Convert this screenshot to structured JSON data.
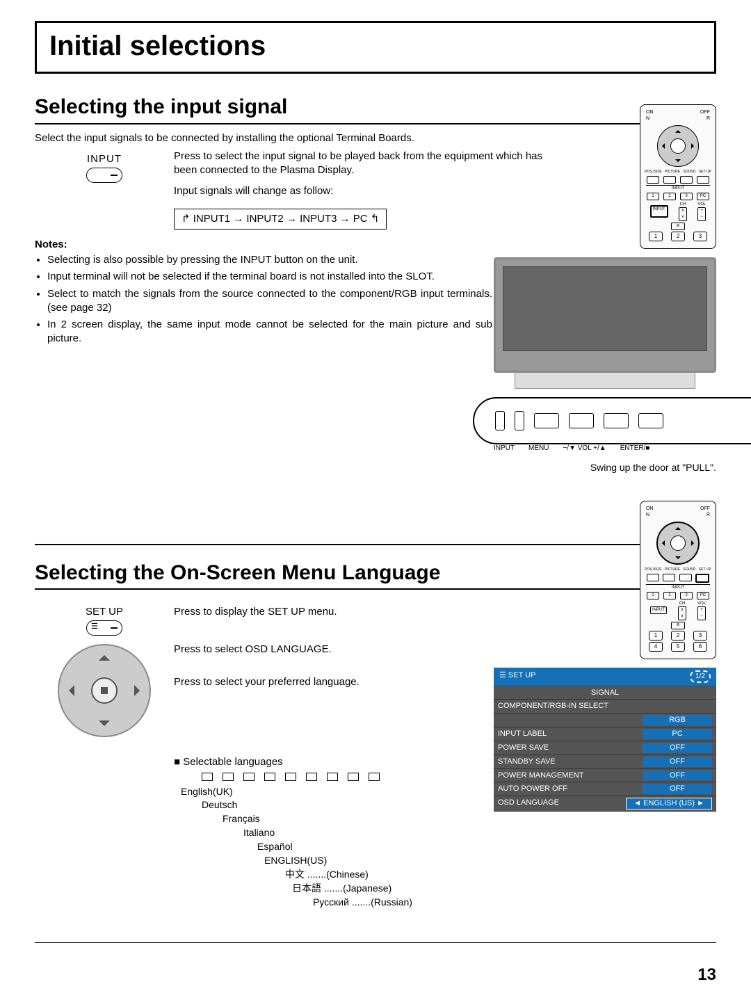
{
  "page": {
    "title": "Initial selections",
    "number": "13"
  },
  "section1": {
    "heading": "Selecting the input signal",
    "intro": "Select the input signals to be connected by installing the optional Terminal Boards.",
    "button_label": "INPUT",
    "press_text": "Press to select the input signal to be played back from the equipment which has been connected to the Plasma Display.",
    "change_text": "Input signals will change as follow:",
    "flow": "INPUT1 → INPUT2 → INPUT3 → PC",
    "notes_label": "Notes:",
    "notes": [
      "Selecting is also possible by pressing the INPUT button on the unit.",
      "Input terminal will not be selected if the terminal board is not installed into the SLOT.",
      "Select to match the signals from the source connected to the component/RGB input terminals. (see page 32)",
      "In 2 screen display, the same input mode cannot be selected for the main picture and sub picture."
    ],
    "tv_caption": "Swing up the door at \"PULL\".",
    "panel_labels": [
      "INPUT",
      "MENU",
      "−/▼ VOL +/▲",
      "ENTER/■"
    ]
  },
  "section2": {
    "heading": "Selecting the On-Screen Menu Language",
    "button_label": "SET UP",
    "step1": "Press to display the SET UP menu.",
    "step2": "Press to select OSD LANGUAGE.",
    "step3": "Press to select your preferred language.",
    "lang_header": "Selectable languages",
    "languages": [
      "English(UK)",
      "Deutsch",
      "Français",
      "Italiano",
      "Español",
      "ENGLISH(US)",
      "中文 .......(Chinese)",
      "日本語 .......(Japanese)",
      "Русский .......(Russian)"
    ]
  },
  "remote": {
    "on": "ON",
    "off": "OFF",
    "n": "N",
    "r": "R",
    "row_labels": [
      "POS./SIZE",
      "PICTURE",
      "SOUND",
      "SET UP"
    ],
    "input_label": "INPUT",
    "nums1": [
      "1",
      "2",
      "3",
      "PC"
    ],
    "ch": "CH",
    "vol": "VOL",
    "input": "INPUT",
    "nums2": [
      "1",
      "2",
      "3"
    ],
    "nums3": [
      "4",
      "5",
      "6"
    ]
  },
  "osd": {
    "title": "SET UP",
    "page": "1/2",
    "signal": "SIGNAL",
    "rows": [
      {
        "l": "COMPONENT/RGB-IN SELECT",
        "v": ""
      },
      {
        "l": "",
        "v": "RGB"
      },
      {
        "l": "INPUT LABEL",
        "v": "PC"
      },
      {
        "l": "POWER SAVE",
        "v": "OFF"
      },
      {
        "l": "STANDBY SAVE",
        "v": "OFF"
      },
      {
        "l": "POWER MANAGEMENT",
        "v": "OFF"
      },
      {
        "l": "AUTO POWER OFF",
        "v": "OFF"
      },
      {
        "l": "OSD LANGUAGE",
        "v": "◄ ENGLISH (US) ►"
      }
    ]
  }
}
